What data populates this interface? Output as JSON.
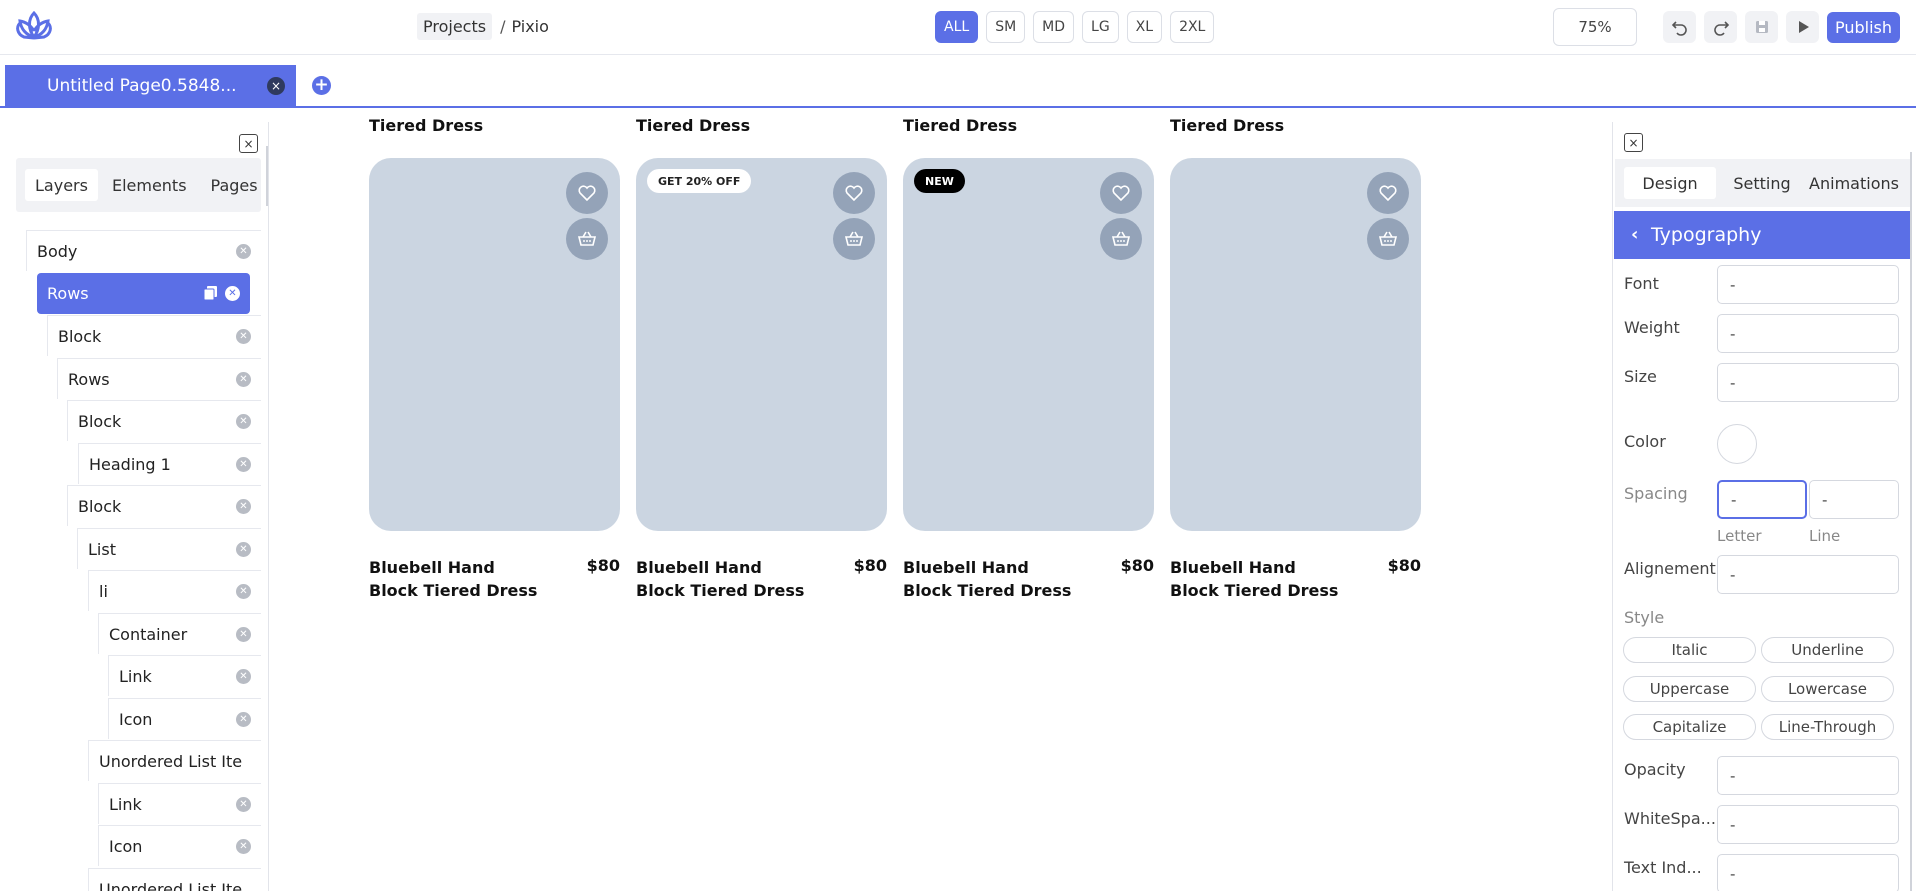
{
  "header": {
    "breadcrumb_projects": "Projects",
    "breadcrumb_sep": "/",
    "breadcrumb_current": "Pixio",
    "breakpoints": [
      "ALL",
      "SM",
      "MD",
      "LG",
      "XL",
      "2XL"
    ],
    "active_breakpoint": "ALL",
    "zoom": "75%",
    "publish_label": "Publish",
    "tool_icons": [
      "undo-icon",
      "redo-icon",
      "save-icon",
      "play-icon"
    ],
    "accent_color": "#5b6fe6"
  },
  "page_tabs": {
    "current": "Untitled Page0.5848...",
    "close_glyph": "×",
    "add_glyph": "+"
  },
  "left_panel": {
    "close_glyph": "×",
    "tabs": [
      "Layers",
      "Elements",
      "Pages"
    ],
    "active_tab": "Layers",
    "layers": [
      {
        "label": "Body"
      },
      {
        "label": "Rows",
        "selected": true
      },
      {
        "label": "Block"
      },
      {
        "label": "Rows"
      },
      {
        "label": "Block"
      },
      {
        "label": "Heading 1"
      },
      {
        "label": "Block"
      },
      {
        "label": "List"
      },
      {
        "label": "li"
      },
      {
        "label": "Container"
      },
      {
        "label": "Link"
      },
      {
        "label": "Icon"
      },
      {
        "label": "Unordered List Ite"
      },
      {
        "label": "Link"
      },
      {
        "label": "Icon"
      },
      {
        "label": "Unordered List Ite"
      }
    ]
  },
  "canvas": {
    "prev_row_title": "Tiered Dress",
    "cards": [
      {
        "name": "Bluebell Hand Block Tiered Dress",
        "price": "$80",
        "badge": ""
      },
      {
        "name": "Bluebell Hand Block Tiered Dress",
        "price": "$80",
        "badge": "GET 20% OFF"
      },
      {
        "name": "Bluebell Hand Block Tiered Dress",
        "price": "$80",
        "badge": "NEW"
      },
      {
        "name": "Bluebell Hand Block Tiered Dress",
        "price": "$80",
        "badge": ""
      }
    ]
  },
  "right_panel": {
    "close_glyph": "×",
    "tabs": [
      "Design",
      "Setting",
      "Animations"
    ],
    "active_tab": "Design",
    "section_title": "Typography",
    "chevron": "‹",
    "props": {
      "font_label": "Font",
      "font_value": "-",
      "weight_label": "Weight",
      "weight_value": "-",
      "size_label": "Size",
      "size_value": "-",
      "color_label": "Color",
      "spacing_label": "Spacing",
      "letter_value": "-",
      "line_value": "-",
      "letter_label": "Letter",
      "line_label": "Line",
      "alignment_label": "Alignement",
      "alignment_value": "-",
      "style_label": "Style",
      "opacity_label": "Opacity",
      "opacity_value": "-",
      "whitespace_label": "WhiteSpa...",
      "whitespace_value": "-",
      "textindent_label": "Text Ind...",
      "textindent_value": "-"
    },
    "style_buttons": [
      "Italic",
      "Underline",
      "Uppercase",
      "Lowercase",
      "Capitalize",
      "Line-Through"
    ]
  }
}
